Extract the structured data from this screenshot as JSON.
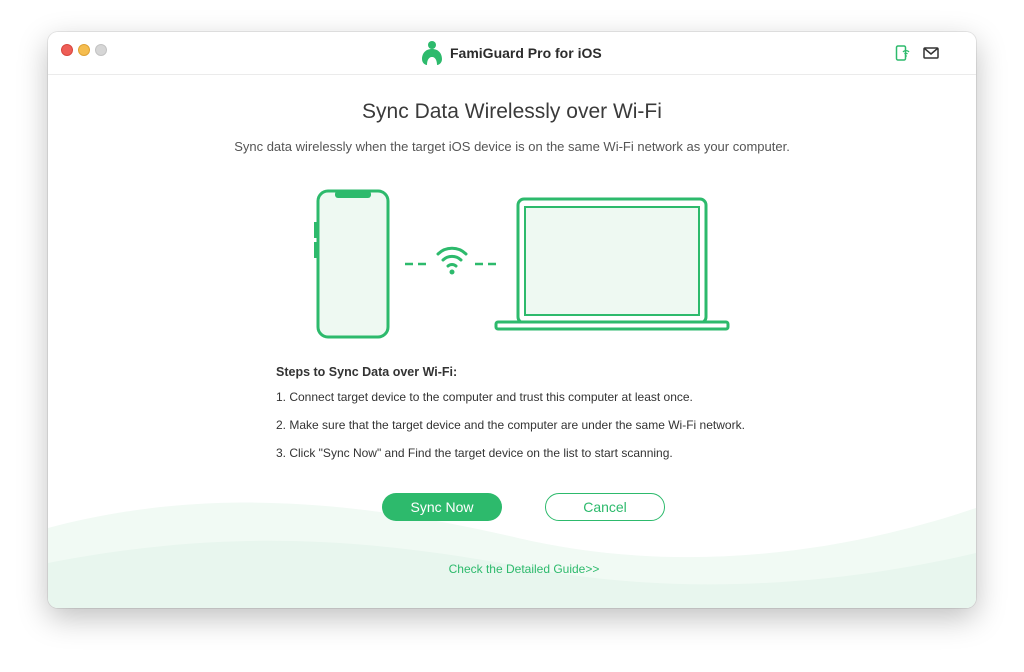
{
  "window": {
    "title": "FamiGuard Pro for iOS"
  },
  "titlebar": {
    "icons": [
      "phone-wifi-icon",
      "mail-icon"
    ]
  },
  "main": {
    "heading": "Sync Data Wirelessly over Wi-Fi",
    "subheading": "Sync data wirelessly when the target iOS device is on the same Wi-Fi network as your computer.",
    "illustration_icons": [
      "phone-icon",
      "wifi-icon",
      "laptop-icon"
    ],
    "steps_title": "Steps to Sync Data over Wi-Fi:",
    "steps": [
      "1. Connect target device to the computer and trust this computer at least once.",
      "2. Make sure that the target device and the computer are under the same Wi-Fi network.",
      "3. Click \"Sync Now\" and Find the target device on the list to start scanning."
    ],
    "sync_button": "Sync Now",
    "cancel_button": "Cancel",
    "guide_link": "Check the Detailed Guide>>"
  },
  "colors": {
    "accent": "#2dba6c",
    "accent_light": "#e6f6ec",
    "text": "#333333"
  }
}
